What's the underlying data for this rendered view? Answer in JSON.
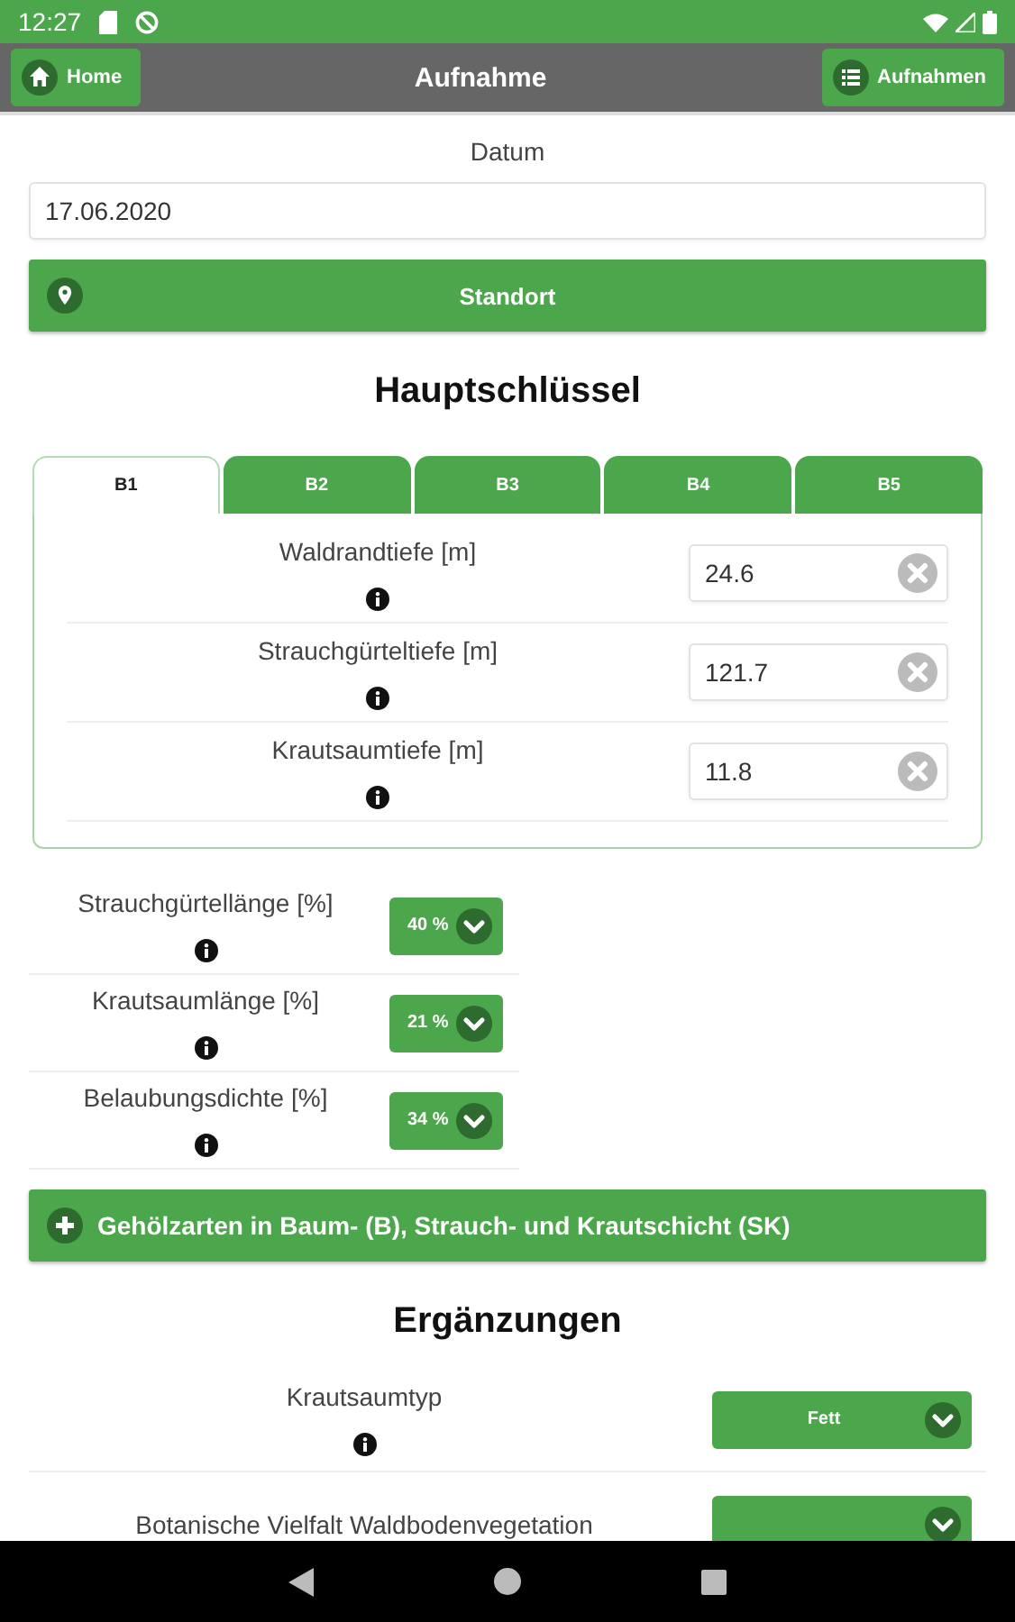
{
  "status_bar": {
    "time": "12:27"
  },
  "header": {
    "home_button": "Home",
    "title": "Aufnahme",
    "list_button": "Aufnahmen"
  },
  "date": {
    "label": "Datum",
    "value": "17.06.2020"
  },
  "location_button": "Standort",
  "main_section": {
    "heading": "Hauptschlüssel",
    "tabs": [
      {
        "label": "B1",
        "selected": true
      },
      {
        "label": "B2",
        "selected": false
      },
      {
        "label": "B3",
        "selected": false
      },
      {
        "label": "B4",
        "selected": false
      },
      {
        "label": "B5",
        "selected": false
      }
    ],
    "fields": [
      {
        "label": "Waldrandtiefe [m]",
        "value": "24.6"
      },
      {
        "label": "Strauchgürteltiefe [m]",
        "value": "121.7"
      },
      {
        "label": "Krautsaumtiefe [m]",
        "value": "11.8"
      }
    ]
  },
  "percent_fields": [
    {
      "label": "Strauchgürtellänge [%]",
      "value": "40 %"
    },
    {
      "label": "Krautsaumlänge [%]",
      "value": "21 %"
    },
    {
      "label": "Belaubungsdichte [%]",
      "value": "34 %"
    }
  ],
  "expand_bar": {
    "label": "Gehölzarten in Baum- (B), Strauch- und Krautschicht (SK)",
    "expanded": false
  },
  "supplements": {
    "heading": "Ergänzungen",
    "fields": [
      {
        "label": "Krautsaumtyp",
        "value": "Fett",
        "info_icon": true
      },
      {
        "label": "Botanische Vielfalt Waldbodenvegetation",
        "info_icon": false
      }
    ]
  }
}
